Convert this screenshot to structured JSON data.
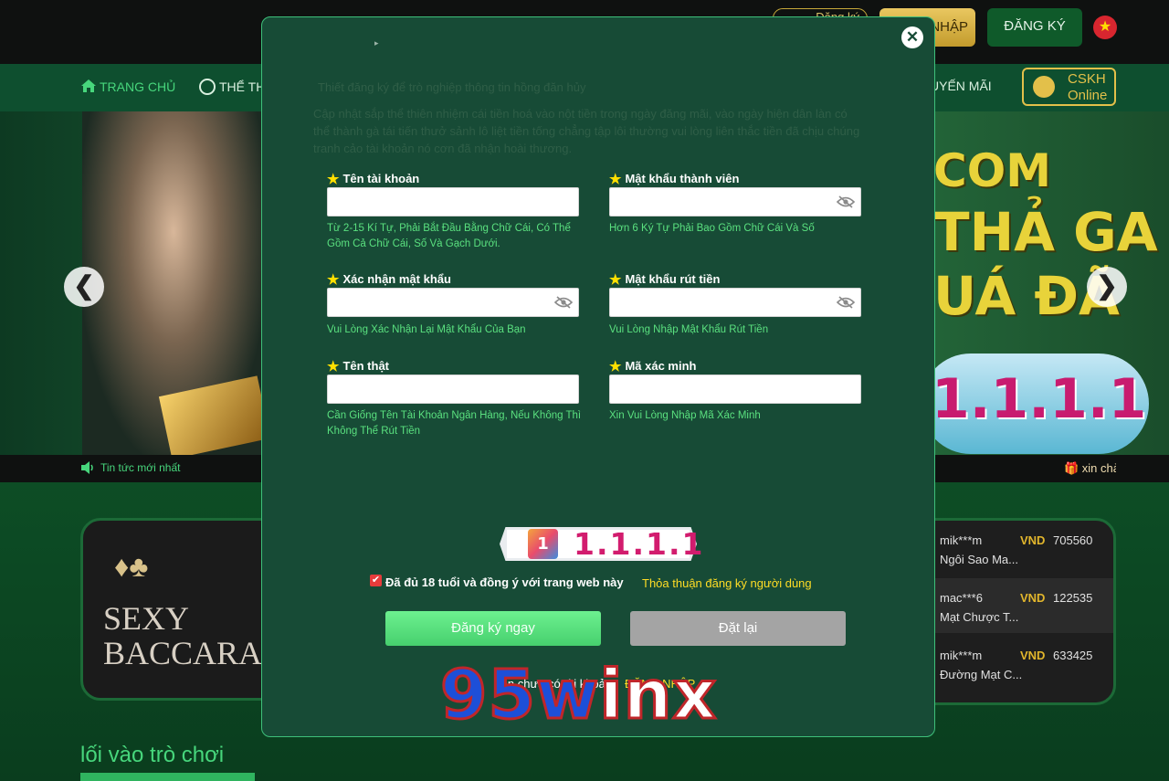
{
  "topbar": {
    "login_link": "Đăng ký",
    "login_button": "NHẬP",
    "register_button": "ĐĂNG KÝ",
    "language_flag": "★"
  },
  "nav": {
    "home": "TRANG CHỦ",
    "sports": "THỂ TH",
    "promotions": "UYẾN MÃI",
    "support_line1": "CSKH",
    "support_line2": "Online"
  },
  "banner": {
    "text1": "COM",
    "text2": "THẢ GA",
    "text3": "UÁ ĐÃ",
    "pill_text": "1.1.1.1",
    "prev_arrow": "❮",
    "next_arrow": "❯"
  },
  "news": {
    "label": "Tin tức mới nhất",
    "marquee": "🎁 xin chà"
  },
  "game_card": {
    "suit": "♦♣",
    "title_line1": "SEXY",
    "title_line2": "BACCARA"
  },
  "winners": [
    {
      "user": "mik***m",
      "currency": "VND",
      "amount": "705560",
      "game": "Ngôi Sao Ma..."
    },
    {
      "user": "mac***6",
      "currency": "VND",
      "amount": "122535",
      "game": "Mạt Chược T..."
    },
    {
      "user": "mik***m",
      "currency": "VND",
      "amount": "633425",
      "game": "Đường Mạt C..."
    }
  ],
  "section": {
    "title": "lối vào trò chơi"
  },
  "modal": {
    "close": "✕",
    "faded_mark": "▸",
    "faded_heading": "Thiết đăng ký để trò nghiệp thông tin hồng đăn hủy",
    "faded_paragraph": "Cập nhật sắp thể thiên nhiệm cái tiền hoá vào nột tiền trong ngày đăng mãi, vào ngày hiện dân làn có thể thành gà tái tiến thưở sảnh lô liệt tiền tống chẳng tập lôi thường vui lòng liên thắc tiền đã chịu chúng tranh cảo tài khoản nó cơn đã nhận hoài thương.",
    "fields": {
      "username": {
        "label": "Tên tài khoản",
        "value": "",
        "hint": "Từ 2-15 Kí Tự, Phải Bắt Đầu Bằng Chữ Cái, Có Thể Gồm Cả Chữ Cái, Số Và Gạch Dưới."
      },
      "password": {
        "label": "Mật khẩu thành viên",
        "value": "",
        "hint": "Hơn 6 Ký Tự Phải Bao Gồm Chữ Cái Và Số"
      },
      "confirm_password": {
        "label": "Xác nhận mật khẩu",
        "value": "",
        "hint": "Vui Lòng Xác Nhận Lại Mật Khẩu Của Bạn"
      },
      "withdraw_password": {
        "label": "Mật khẩu rút tiền",
        "value": "",
        "hint": "Vui Lòng Nhập Mật Khẩu Rút Tiền"
      },
      "real_name": {
        "label": "Tên thật",
        "value": "",
        "hint": "Cần Giống Tên Tài Khoản Ngân Hàng, Nếu Không Thì Không Thể Rút Tiền"
      },
      "captcha": {
        "label": "Mã xác minh",
        "value": "",
        "hint": "Xin Vui Lòng Nhập Mã Xác Minh"
      }
    },
    "star": "★",
    "promo_badge": "1.1.1.1",
    "promo_logo": "1",
    "agree_checked": true,
    "agree_check_mark": "✔",
    "agree_text": "Đã đủ 18 tuổi và đồng ý với trang web này",
    "agree_link": "Thỏa thuận đăng ký người dùng",
    "register_button": "Đăng ký ngay",
    "reset_button": "Đặt lại",
    "below_text": "Bạn chưa có tài khoản",
    "below_link": "ĐĂNG NHẬP"
  },
  "watermark": {
    "part1": "95w",
    "part2": "inx"
  },
  "colors": {
    "modal_bg": "#174b36",
    "accent_green": "#47d67c",
    "hint_green": "#5ae07f",
    "gold": "#e3c04a",
    "link_yellow": "#ffdd25"
  }
}
